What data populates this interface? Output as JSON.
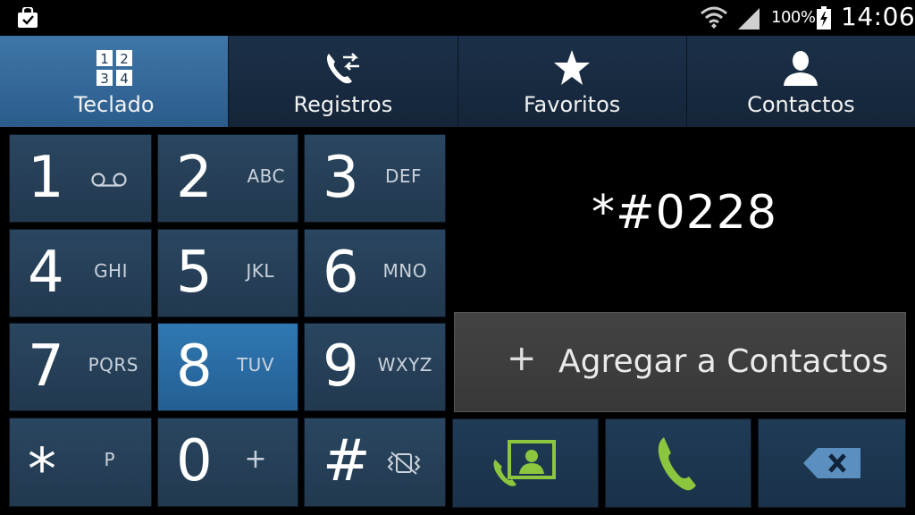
{
  "status_bar": {
    "battery": "100%",
    "time": "14:06"
  },
  "tabs": [
    {
      "label": "Teclado",
      "icon": "keypad-icon",
      "active": true
    },
    {
      "label": "Registros",
      "icon": "call-log-icon",
      "active": false
    },
    {
      "label": "Favoritos",
      "icon": "star-icon",
      "active": false
    },
    {
      "label": "Contactos",
      "icon": "contact-person-icon",
      "active": false
    }
  ],
  "keys": [
    {
      "digit": "1",
      "letters": "",
      "icon": "voicemail-icon"
    },
    {
      "digit": "2",
      "letters": "ABC"
    },
    {
      "digit": "3",
      "letters": "DEF"
    },
    {
      "digit": "4",
      "letters": "GHI"
    },
    {
      "digit": "5",
      "letters": "JKL"
    },
    {
      "digit": "6",
      "letters": "MNO"
    },
    {
      "digit": "7",
      "letters": "PQRS"
    },
    {
      "digit": "8",
      "letters": "TUV",
      "pressed": true
    },
    {
      "digit": "9",
      "letters": "WXYZ"
    },
    {
      "digit": "*",
      "letters": "P"
    },
    {
      "digit": "0",
      "letters": "+"
    },
    {
      "digit": "#",
      "letters": "",
      "icon": "vibrate-mute-icon"
    }
  ],
  "dialed_number": "*#0228",
  "add_contact": {
    "plus": "+",
    "label": "Agregar a Contactos"
  },
  "actions": [
    {
      "name": "video-call-button",
      "icon": "video-call-icon",
      "color": "#8cc63f"
    },
    {
      "name": "call-button",
      "icon": "phone-icon",
      "color": "#8cc63f"
    },
    {
      "name": "backspace-button",
      "icon": "backspace-icon",
      "color": "#5b8fc0"
    }
  ]
}
